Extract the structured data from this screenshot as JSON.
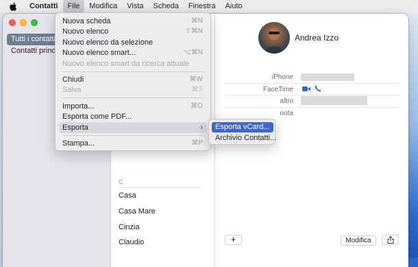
{
  "menubar": {
    "app_name": "Contatti",
    "items": [
      "File",
      "Modifica",
      "Vista",
      "Scheda",
      "Finestra",
      "Aiuto"
    ],
    "active": "File"
  },
  "sidebar": {
    "items": [
      {
        "label": "Tutti i contatti",
        "selected": true
      },
      {
        "label": "Contatti principali",
        "selected": false
      }
    ]
  },
  "contact_list": {
    "section": "C",
    "items": [
      "Casa",
      "Casa Mare",
      "Cinzia",
      "Claudio"
    ]
  },
  "detail": {
    "name": "Andrea Izzo",
    "fields": {
      "iphone_label": "iPhone",
      "facetime_label": "FaceTime",
      "altro_label": "altro",
      "nota_label": "nota"
    },
    "add_button": "+",
    "edit_button": "Modifica"
  },
  "file_menu": {
    "items": [
      {
        "label": "Nuova scheda",
        "shortcut": "⌘N"
      },
      {
        "label": "Nuovo elenco",
        "shortcut": "⇧⌘N"
      },
      {
        "label": "Nuovo elenco da selezione",
        "shortcut": ""
      },
      {
        "label": "Nuovo elenco smart...",
        "shortcut": "⌥⌘N"
      },
      {
        "label": "Nuovo elenco smart da ricerca attuale",
        "shortcut": ""
      },
      {
        "label": "Chiudi",
        "shortcut": "⌘W"
      },
      {
        "label": "Salva",
        "shortcut": "⌘S"
      },
      {
        "label": "Importa...",
        "shortcut": "⌘O"
      },
      {
        "label": "Esporta come PDF...",
        "shortcut": ""
      },
      {
        "label": "Esporta",
        "shortcut": ""
      },
      {
        "label": "Stampa...",
        "shortcut": "⌘P"
      }
    ]
  },
  "export_submenu": {
    "items": [
      "Esporta vCard...",
      "Archivio Contatti..."
    ]
  },
  "colors": {
    "selection_blue": "#3d68c9",
    "sidebar_selected": "#6b7c93",
    "menu_bg": "#ececee"
  }
}
